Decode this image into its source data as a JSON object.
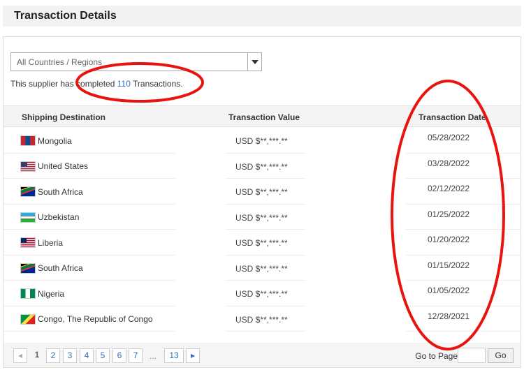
{
  "title": "Transaction Details",
  "filter": {
    "selected": "All Countries / Regions"
  },
  "summary": {
    "prefix": "This supplier has completed ",
    "count": "110",
    "suffix": " Transactions."
  },
  "columns": [
    "Shipping Destination",
    "Transaction Value",
    "Transaction Date"
  ],
  "rows": [
    {
      "dest": "Mongolia",
      "value": "USD $**,***.**",
      "date": "05/28/2022",
      "flag": "mongolia"
    },
    {
      "dest": "United States",
      "value": "USD $**,***.**",
      "date": "03/28/2022",
      "flag": "us"
    },
    {
      "dest": "South Africa",
      "value": "USD $**,***.**",
      "date": "02/12/2022",
      "flag": "za"
    },
    {
      "dest": "Uzbekistan",
      "value": "USD $**,***.**",
      "date": "01/25/2022",
      "flag": "uz"
    },
    {
      "dest": "Liberia",
      "value": "USD $**,***.**",
      "date": "01/20/2022",
      "flag": "lr"
    },
    {
      "dest": "South Africa",
      "value": "USD $**,***.**",
      "date": "01/15/2022",
      "flag": "za"
    },
    {
      "dest": "Nigeria",
      "value": "USD $**,***.**",
      "date": "01/05/2022",
      "flag": "ng"
    },
    {
      "dest": "Congo, The Republic of Congo",
      "value": "USD $**,***.**",
      "date": "12/28/2021",
      "flag": "cg"
    }
  ],
  "pagination": {
    "current": "1",
    "pages": [
      "2",
      "3",
      "4",
      "5",
      "6",
      "7"
    ],
    "ellipsis": "...",
    "last": "13",
    "goto_label": "Go to Page",
    "go_label": "Go"
  },
  "annotation_color": "#e8140f"
}
